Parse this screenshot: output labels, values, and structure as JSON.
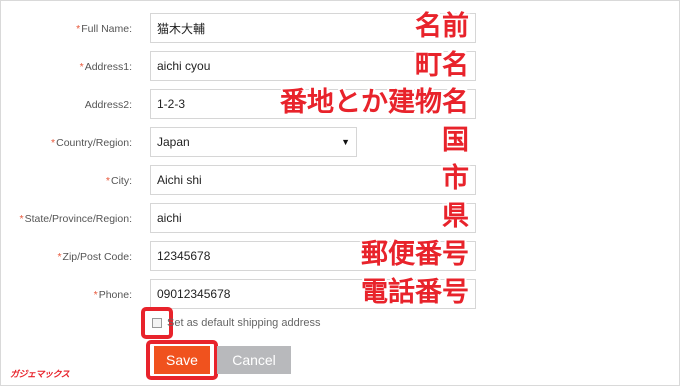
{
  "form": {
    "required_mark": "*",
    "fields": [
      {
        "label": "Full Name:",
        "required": true,
        "value": "猫木大輔",
        "annotation": "名前"
      },
      {
        "label": "Address1:",
        "required": true,
        "value": "aichi cyou",
        "annotation": "町名"
      },
      {
        "label": "Address2:",
        "required": false,
        "value": "1-2-3",
        "annotation": "番地とか建物名"
      },
      {
        "label": "Country/Region:",
        "required": true,
        "value": "Japan",
        "annotation": "国",
        "type": "select"
      },
      {
        "label": "City:",
        "required": true,
        "value": "Aichi shi",
        "annotation": "市"
      },
      {
        "label": "State/Province/Region:",
        "required": true,
        "value": "aichi",
        "annotation": "県"
      },
      {
        "label": "Zip/Post Code:",
        "required": true,
        "value": "12345678",
        "annotation": "郵便番号"
      },
      {
        "label": "Phone:",
        "required": true,
        "value": "09012345678",
        "annotation": "電話番号"
      }
    ],
    "select_caret": "▼",
    "default_address_label": "Set as default shipping address",
    "default_address_checked": false,
    "save_label": "Save",
    "cancel_label": "Cancel"
  },
  "watermark": "ガジェマックス",
  "colors": {
    "annotation_red": "#e8232b",
    "required_asterisk": "#e8573a",
    "save_button": "#f0521e",
    "cancel_button": "#b8b9bc"
  }
}
